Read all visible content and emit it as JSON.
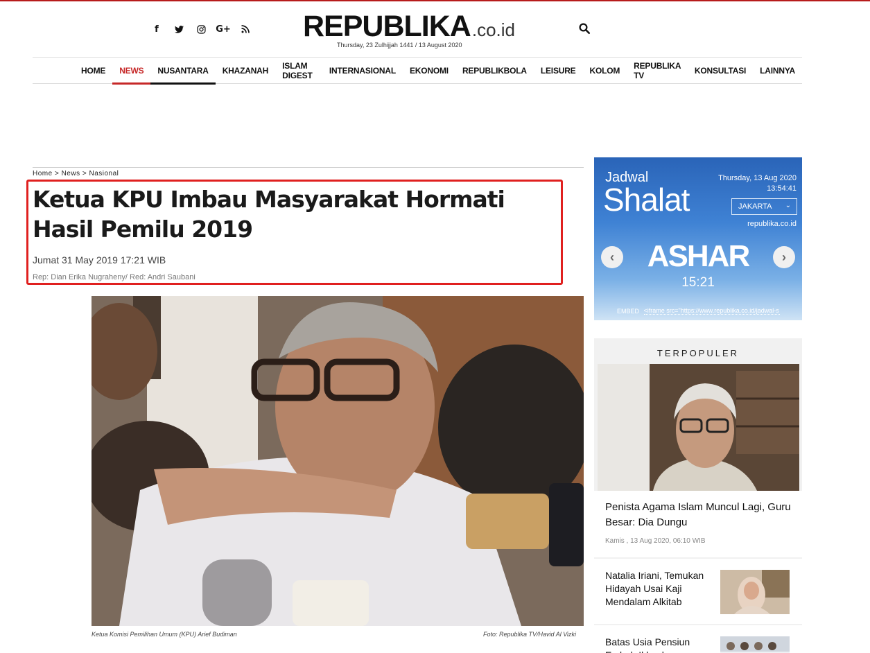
{
  "header": {
    "logo_main": "REPUBLIKA",
    "logo_tld": ".co.id",
    "dateline": "Thursday, 23 Zulhijjah 1441 / 13 August 2020",
    "social": [
      "f",
      "t",
      "ig",
      "G+",
      "rss"
    ]
  },
  "nav": {
    "items": [
      "HOME",
      "NEWS",
      "NUSANTARA",
      "KHAZANAH",
      "ISLAM DIGEST",
      "INTERNASIONAL",
      "EKONOMI",
      "REPUBLIKBOLA",
      "LEISURE",
      "KOLOM",
      "REPUBLIKA TV",
      "KONSULTASI",
      "LAINNYA"
    ]
  },
  "article": {
    "breadcrumb": "Home > News > Nasional",
    "headline": "Ketua KPU Imbau Masyarakat Hormati Hasil Pemilu 2019",
    "date": "Jumat 31 May 2019 17:21 WIB",
    "reporter": "Rep: Dian Erika Nugraheny/ Red: Andri Saubani",
    "caption": "Ketua Komisi Pemilihan Umum (KPU) Arief Budiman",
    "credit": "Foto: Republika TV/Havid Al Vizki"
  },
  "shalat": {
    "jadwal": "Jadwal",
    "title": "Shalat",
    "date": "Thursday, 13 Aug 2020",
    "time": "13:54:41",
    "city": "JAKARTA",
    "site": "republika.co.id",
    "prayer": "ASHAR",
    "prayer_time": "15:21",
    "embed_label": "EMBED",
    "embed_code": "<iframe src=\"https://www.republika.co.id/jadwal-s"
  },
  "popular": {
    "title": "TERPOPULER",
    "main": {
      "headline": "Penista Agama Islam Muncul Lagi, Guru Besar: Dia Dungu",
      "meta": "Kamis , 13 Aug 2020, 06:10 WIB"
    },
    "items": [
      {
        "headline": "Natalia Iriani, Temukan Hidayah Usai Kaji Mendalam Alkitab"
      },
      {
        "headline": "Batas Usia Pensiun Embah Ikhsal"
      }
    ]
  },
  "colors": {
    "brand_red": "#c62828",
    "highlight_border": "#e0201f",
    "shalat_blue": "#3f82d4"
  }
}
